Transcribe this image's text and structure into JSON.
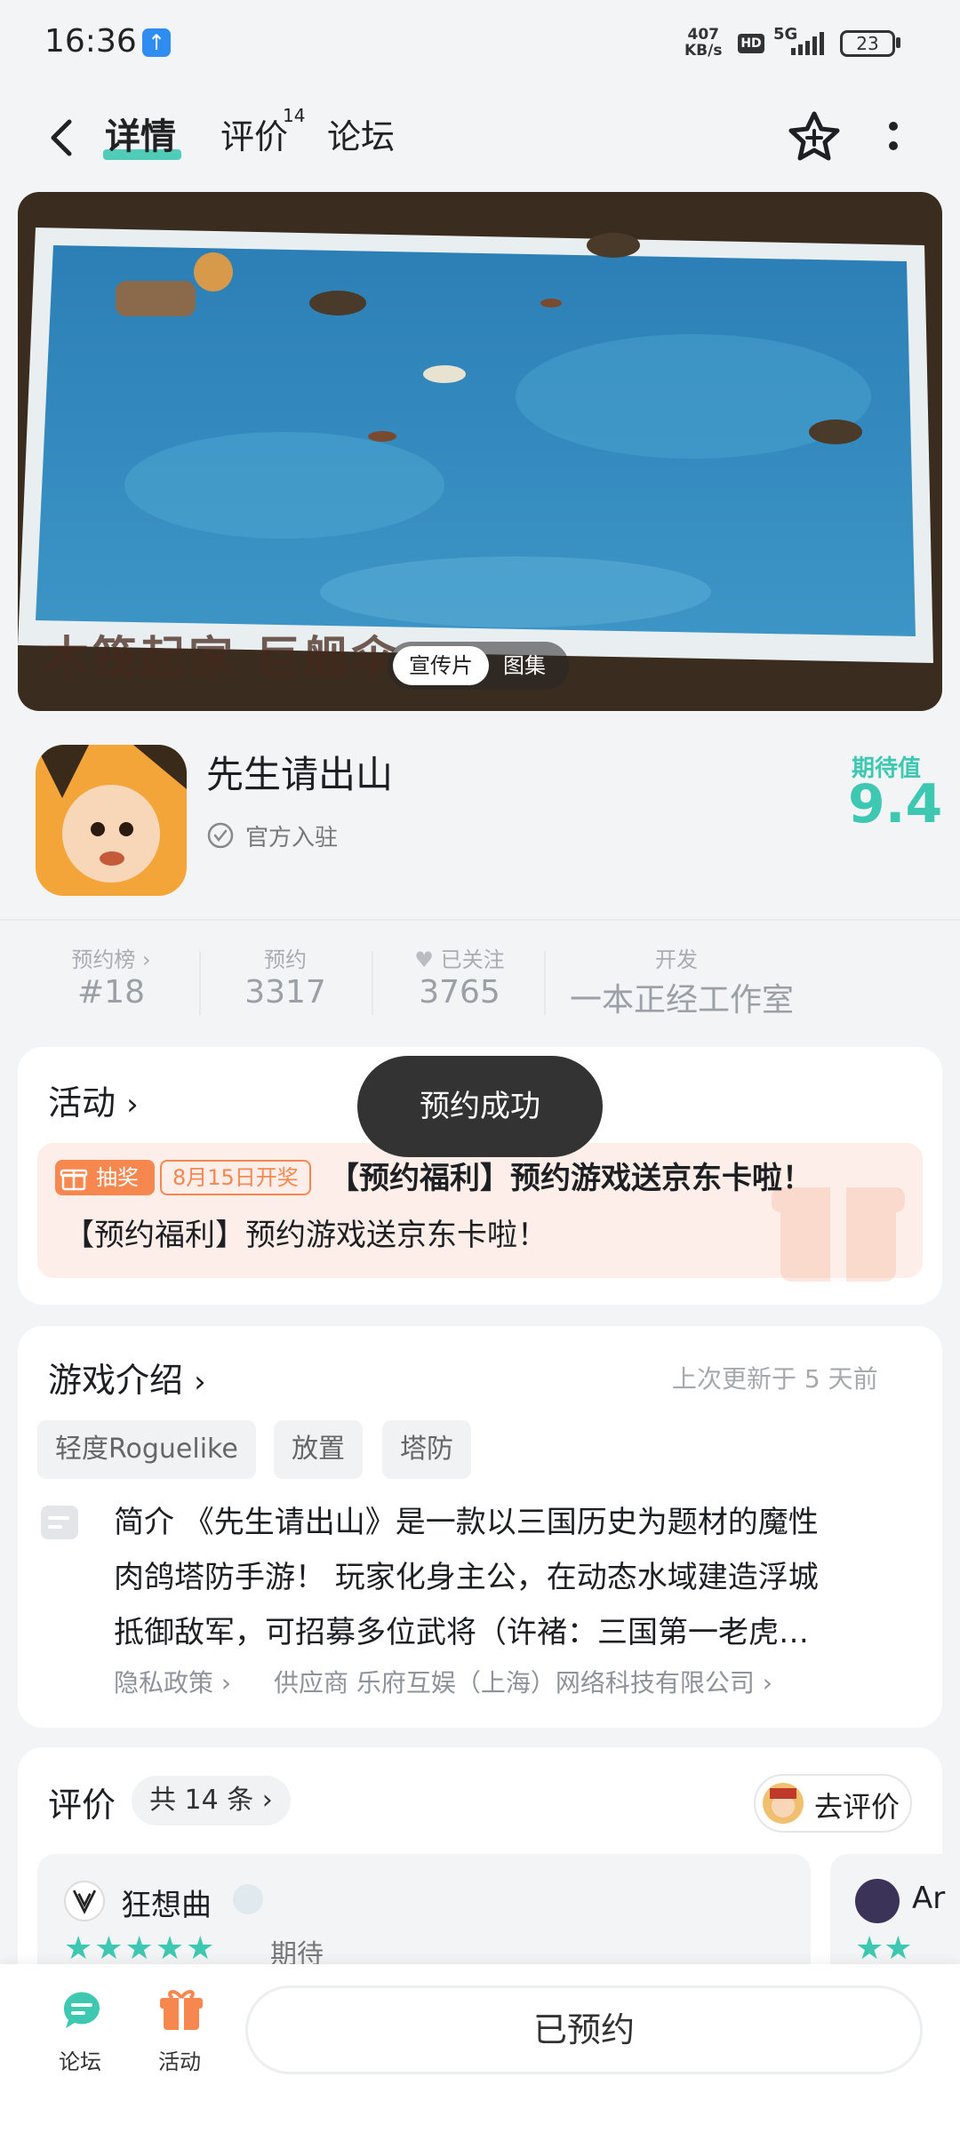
{
  "status_bar": {
    "time": "16:36",
    "net_speed_value": "407",
    "net_speed_unit": "KB/s",
    "hd": "HD",
    "net_type": "5G",
    "battery": "23"
  },
  "header": {
    "tabs": [
      {
        "label": "详情"
      },
      {
        "label": "评价"
      },
      {
        "label": "论坛"
      }
    ],
    "review_count": "14"
  },
  "banner": {
    "caption": "木筏起家 巨舰伞",
    "media_tabs": [
      "宣传片",
      "图集"
    ]
  },
  "app": {
    "name": "先生请出山",
    "official": "官方入驻",
    "expect_label": "期待值",
    "expect_score": "9.4"
  },
  "stats": [
    {
      "label": "预约榜 ›",
      "value": "#18"
    },
    {
      "label": "预约",
      "value": "3317"
    },
    {
      "label": "已关注",
      "value": "3765"
    },
    {
      "label": "开发",
      "value": "一本正经工作室"
    }
  ],
  "toast": "预约成功",
  "activity": {
    "title": "活动",
    "lottery_tag": "抽奖",
    "date_tag": "8月15日开奖",
    "event_title": "【预约福利】预约游戏送京东卡啦！",
    "event_desc": "【预约福利】预约游戏送京东卡啦！"
  },
  "intro": {
    "title": "游戏介绍",
    "updated": "上次更新于 5 天前",
    "tags": [
      "轻度Roguelike",
      "放置",
      "塔防"
    ],
    "lines": [
      "简介 《先生请出山》是一款以三国历史为题材的魔性",
      "肉鸽塔防手游！ 玩家化身主公，在动态水域建造浮城",
      "抵御敌军，可招募多位武将（许褚：三国第一老虎…"
    ],
    "privacy": "隐私政策",
    "supplier": "供应商 乐府互娱（上海）网络科技有限公司"
  },
  "review": {
    "title": "评价",
    "count": "共 14 条",
    "go_review": "去评价",
    "reviews": [
      {
        "name": "狂想曲",
        "stars": "★★★★★",
        "tag": "期待"
      },
      {
        "name": "Ar",
        "stars": "★★"
      }
    ]
  },
  "bottom_bar": {
    "forum": "论坛",
    "activity": "活动",
    "reserved": "已预约"
  },
  "colors": {
    "accent": "#3ec8b2",
    "orange": "#f5874f",
    "activity_bg": "#fdeee9",
    "toast_bg": "#333333"
  }
}
